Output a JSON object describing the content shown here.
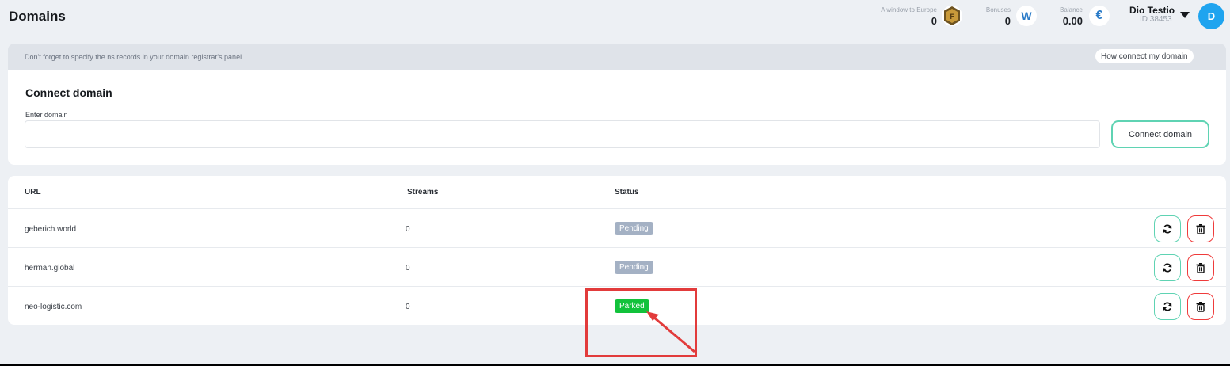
{
  "header": {
    "title": "Domains",
    "stats": [
      {
        "label": "A window to Europe",
        "value": "0",
        "icon": "coin-icon"
      },
      {
        "label": "Bonuses",
        "value": "0",
        "icon": "bonus-w-icon",
        "glyph": "W"
      },
      {
        "label": "Balance",
        "value": "0.00",
        "icon": "euro-icon",
        "glyph": "€"
      }
    ],
    "user": {
      "name": "Dio Testio",
      "id": "ID 38453",
      "avatar": "D"
    }
  },
  "notice": {
    "text": "Don't forget to specify the ns records in your domain registrar's panel",
    "how_label": "How connect my domain"
  },
  "connect": {
    "title": "Connect domain",
    "field_label": "Enter domain",
    "input_value": "",
    "button_label": "Connect domain"
  },
  "table": {
    "headers": {
      "url": "URL",
      "streams": "Streams",
      "status": "Status"
    },
    "rows": [
      {
        "url": "geberich.world",
        "streams": "0",
        "status": "Pending"
      },
      {
        "url": "herman.global",
        "streams": "0",
        "status": "Pending"
      },
      {
        "url": "neo-logistic.com",
        "streams": "0",
        "status": "Parked"
      }
    ]
  },
  "colors": {
    "accent": "#5fd3b3",
    "danger": "#ef3b3b",
    "parked": "#12c23b",
    "pending": "#a4b1c4",
    "avatar": "#1fa4ef",
    "annotation": "#e23b3b"
  }
}
